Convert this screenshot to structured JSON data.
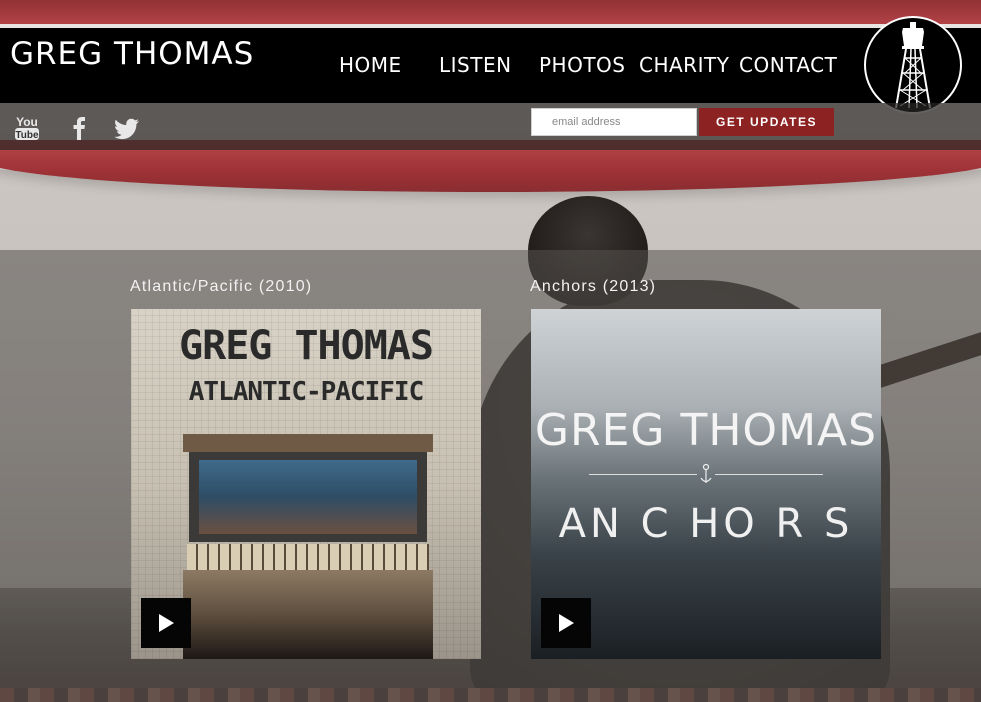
{
  "header": {
    "logo_text": "GREG THOMAS",
    "nav": [
      "HOME",
      "LISTEN",
      "PHOTOS",
      "CHARITY",
      "CONTACT"
    ]
  },
  "social": {
    "youtube_label": "You Tube",
    "icons": [
      "youtube-icon",
      "facebook-icon",
      "twitter-icon"
    ]
  },
  "subscribe": {
    "email_placeholder": "email address",
    "button_label": "GET UPDATES"
  },
  "albums": [
    {
      "title": "Atlantic/Pacific (2010)",
      "cover_line1": "GREG THOMAS",
      "cover_line2": "ATLANTIC-PACIFIC"
    },
    {
      "title": "Anchors (2013)",
      "cover_line1": "GREG THOMAS",
      "cover_line2": "AN C HO R S"
    }
  ],
  "colors": {
    "header_bg": "#000000",
    "updates_button": "#8d2222",
    "play_button": "#050505"
  }
}
